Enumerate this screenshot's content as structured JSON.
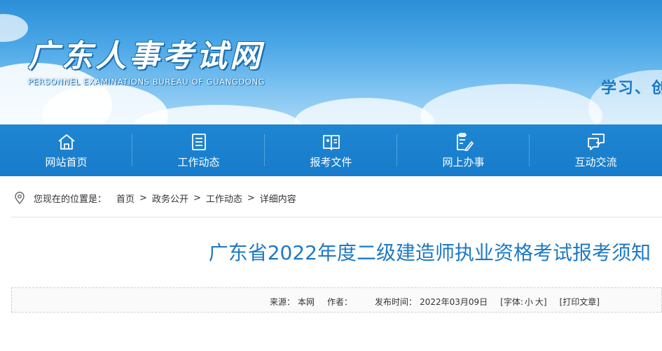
{
  "header": {
    "logo_cn": "广东人事考试网",
    "logo_en": "PERSONNEL EXAMINATIONS BUREAU OF GUANGDONG",
    "slogan": "学习、创"
  },
  "nav": {
    "items": [
      {
        "label": "网站首页",
        "icon": "home-icon"
      },
      {
        "label": "工作动态",
        "icon": "list-icon"
      },
      {
        "label": "报考文件",
        "icon": "book-icon"
      },
      {
        "label": "网上办事",
        "icon": "edit-clipboard-icon"
      },
      {
        "label": "互动交流",
        "icon": "chat-icon"
      }
    ]
  },
  "breadcrumb": {
    "prefix": "您现在的位置是：",
    "items": [
      "首页",
      "政务公开",
      "工作动态",
      "详细内容"
    ],
    "separator": ">"
  },
  "article": {
    "title": "广东省2022年度二级建造师执业资格考试报考须知",
    "meta": {
      "source_label": "来源：",
      "source_value": "本网",
      "author_label": "作者：",
      "publish_label": "发布时间：",
      "publish_value": "2022年03月09日",
      "font_open": "[字体:",
      "font_small": "小",
      "font_large": "大",
      "font_close": "]",
      "print_label": "[打印文章]"
    }
  },
  "colors": {
    "nav_bg": "#1f86d3",
    "title": "#1d79c4",
    "banner_top": "#2b8fd8"
  }
}
